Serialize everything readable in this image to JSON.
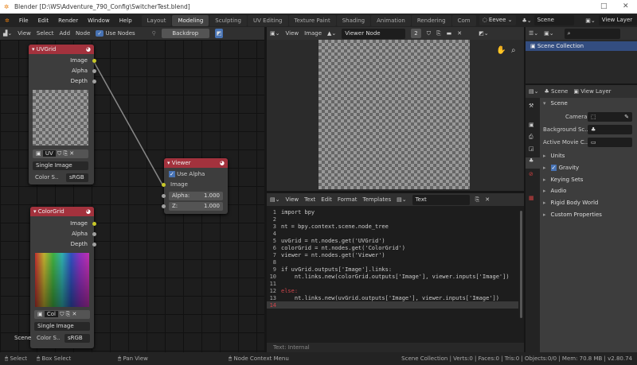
{
  "window": {
    "title": "Blender [D:\\WS\\Adventure_790_Config\\SwitcherTest.blend]"
  },
  "menus": [
    "File",
    "Edit",
    "Render",
    "Window",
    "Help"
  ],
  "workspaces": [
    "Layout",
    "Modeling",
    "Sculpting",
    "UV Editing",
    "Texture Paint",
    "Shading",
    "Animation",
    "Rendering",
    "Com"
  ],
  "active_workspace": "Modeling",
  "topright": {
    "engine": "Eevee",
    "scene": "Scene",
    "view_layer": "View Layer"
  },
  "node_editor": {
    "header": [
      "View",
      "Select",
      "Add",
      "Node"
    ],
    "use_nodes": "Use Nodes",
    "backdrop": "Backdrop",
    "nodes": {
      "uvgrid": {
        "title": "UVGrid",
        "outputs": [
          "Image",
          "Alpha",
          "Depth"
        ],
        "image_name": "UV",
        "source": "Single Image",
        "color_label": "Color S..",
        "color_value": "sRGB"
      },
      "viewer": {
        "title": "Viewer",
        "use_alpha": "Use Alpha",
        "input": "Image",
        "alpha_label": "Alpha:",
        "alpha_value": "1.000",
        "z_label": "Z:",
        "z_value": "1.000"
      },
      "colorgrid": {
        "title": "ColorGrid",
        "outputs": [
          "Image",
          "Alpha",
          "Depth"
        ],
        "image_name": "Col",
        "source": "Single Image",
        "color_label": "Color S..",
        "color_value": "sRGB"
      }
    },
    "frame_label": "Scene"
  },
  "image_editor": {
    "header": [
      "View",
      "Image"
    ],
    "image": "Viewer Node",
    "slot": "2"
  },
  "text_editor": {
    "header": [
      "View",
      "Text",
      "Edit",
      "Format",
      "Templates"
    ],
    "text_name": "Text",
    "footer": "Text: Internal",
    "lines": [
      "import bpy",
      "",
      "nt = bpy.context.scene.node_tree",
      "",
      "uvGrid = nt.nodes.get('UVGrid')",
      "colorGrid = nt.nodes.get('ColorGrid')",
      "viewer = nt.nodes.get('Viewer')",
      "",
      "if uvGrid.outputs['Image'].links:",
      "    nt.links.new(colorGrid.outputs['Image'], viewer.inputs['Image'])",
      "",
      "else:",
      "    nt.links.new(uvGrid.outputs['Image'], viewer.inputs['Image'])",
      ""
    ]
  },
  "outliner": {
    "items": [
      "Scene Collection"
    ]
  },
  "properties": {
    "tabs": [
      "Scene",
      "View Layer"
    ],
    "panel": "Scene",
    "camera_label": "Camera",
    "bg_label": "Background Sc..",
    "clip_label": "Active Movie C..",
    "sections": [
      "Units",
      "Gravity",
      "Keying Sets",
      "Audio",
      "Rigid Body World",
      "Custom Properties"
    ]
  },
  "status": {
    "select": "Select",
    "box_select": "Box Select",
    "pan": "Pan View",
    "context": "Node Context Menu",
    "stats": "Scene Collection | Verts:0 | Faces:0 | Tris:0 | Objects:0/0 | Mem: 70.8 MB | v2.80.74"
  }
}
